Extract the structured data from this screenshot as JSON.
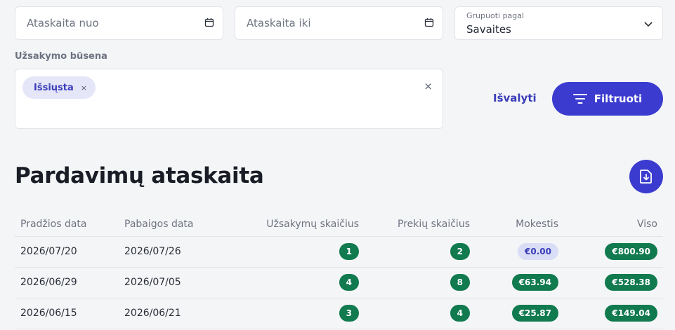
{
  "filters": {
    "date_from": {
      "placeholder": "Ataskaita nuo",
      "icon": "calendar-icon"
    },
    "date_to": {
      "placeholder": "Ataskaita iki",
      "icon": "calendar-icon"
    },
    "group_by": {
      "label": "Grupuoti pagal",
      "value": "Savaites",
      "icon": "chevron-down-icon"
    },
    "status": {
      "label": "Užsakymo būsena",
      "chips": [
        {
          "label": "Išsiųsta",
          "remove": "×"
        }
      ],
      "clear_icon": "×"
    },
    "clear_label": "Išvalyti",
    "filter_label": "Filtruoti"
  },
  "report": {
    "title": "Pardavimų ataskaita",
    "download_icon": "download-icon",
    "columns": [
      "Pradžios data",
      "Pabaigos data",
      "Užsakymų skaičius",
      "Prekių skaičius",
      "Mokestis",
      "Viso"
    ],
    "rows": [
      {
        "start": "2026/07/20",
        "end": "2026/07/26",
        "orders": "1",
        "items": "2",
        "fee": "€0.00",
        "total": "€800.90"
      },
      {
        "start": "2026/06/29",
        "end": "2026/07/05",
        "orders": "4",
        "items": "8",
        "fee": "€63.94",
        "total": "€528.38"
      },
      {
        "start": "2026/06/15",
        "end": "2026/06/21",
        "orders": "3",
        "items": "4",
        "fee": "€25.87",
        "total": "€149.04"
      }
    ]
  },
  "colors": {
    "accent": "#3b3ccf",
    "badge_green": "#117a4f",
    "badge_light": "#d9ddf5"
  }
}
